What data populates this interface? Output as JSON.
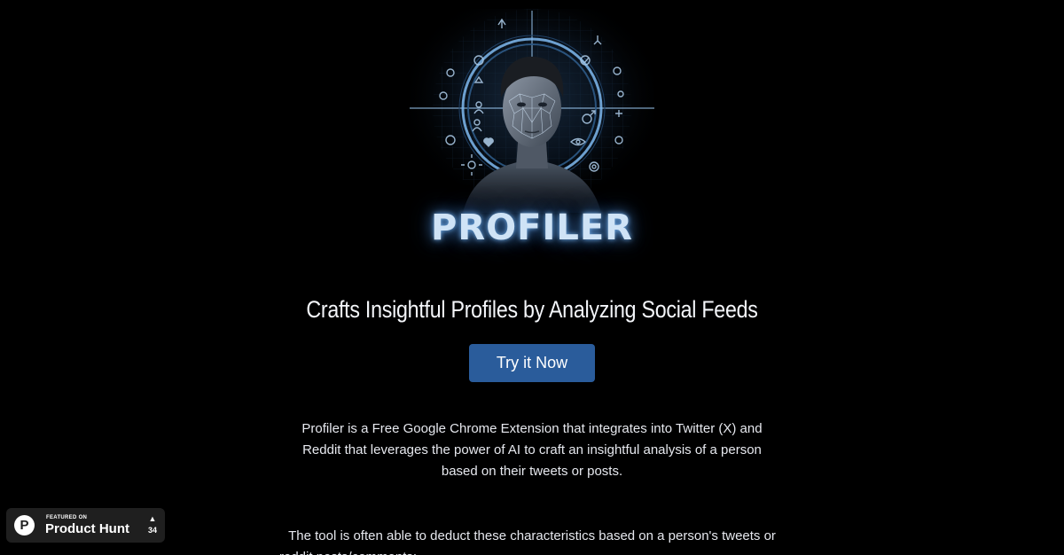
{
  "hero": {
    "logo_text": "PROFILER"
  },
  "headline": "Crafts Insightful Profiles by Analyzing Social Feeds",
  "cta": {
    "label": "Try it Now"
  },
  "description": "Profiler is a Free Google Chrome Extension that integrates into Twitter (X) and Reddit that leverages the power of AI to craft an insightful analysis of a person based on their tweets or posts.",
  "description_2": "The tool is often able to deduct these characteristics based on a person's tweets or",
  "description_2_cont": "reddit posts/comments:",
  "product_hunt": {
    "featured_label": "FEATURED ON",
    "name": "Product Hunt",
    "logo_letter": "P",
    "arrow": "▲",
    "upvotes": "34"
  },
  "colors": {
    "background": "#000000",
    "button": "#2a5c9b",
    "glow": "#6fa8e8",
    "badge": "#1f1f1f"
  }
}
